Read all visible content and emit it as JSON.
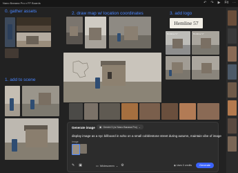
{
  "topbar": {
    "title": "Nano Banana Pro x FF Boards",
    "tool_icons": [
      "↶",
      "↷",
      "▶",
      "⋯"
    ],
    "zoom": "Fit"
  },
  "labels": {
    "gather": {
      "num": "0.",
      "text": "gather assets"
    },
    "draw_map": {
      "num": "2.",
      "text": "draw map w/ location coordinates"
    },
    "add_logo": {
      "num": "3.",
      "text": "add logo"
    },
    "add_to_scene": {
      "num": "1.",
      "text": "add to scene"
    }
  },
  "logo": {
    "text": "Hemline 57"
  },
  "generate": {
    "label": "Generate image",
    "model_icon": "G",
    "model": "Gemini 3 (w/ Nano Banana Pro)",
    "prompt": "display image as a nyc billboard in soho on a small cobblestone street during autumn, maintain vibe of image",
    "image_label": "Image",
    "ratio": "Widescreen",
    "credits": "Uses 0 credits",
    "button": "Generate",
    "icons": {
      "brush": "✎",
      "image": "▣",
      "ratio": "▭",
      "chevron": "⌄",
      "settings": "⚙",
      "credits": "◉"
    }
  },
  "colors": {
    "label_blue": "#4a86ff",
    "accent": "#3b63fb"
  }
}
